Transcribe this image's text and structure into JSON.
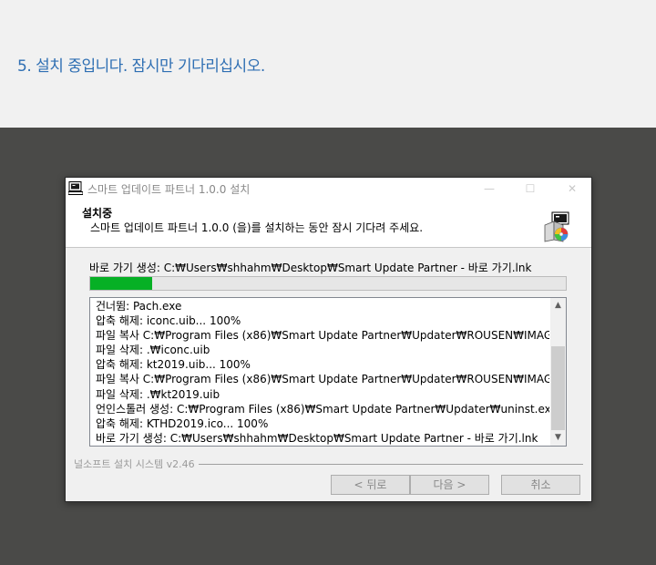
{
  "page": {
    "heading": "5. 설치 중입니다. 잠시만 기다리십시오."
  },
  "window": {
    "title": "스마트 업데이트 파트너 1.0.0  설치",
    "header_title": "설치중",
    "header_subtitle": "스마트 업데이트 파트너 1.0.0 (을)를 설치하는 동안 잠시 기다려 주세요.",
    "controls": {
      "minimize": "—",
      "maximize": "☐",
      "close": "✕"
    }
  },
  "progress": {
    "status_text": "바로 가기 생성: C:₩Users₩shhahm₩Desktop₩Smart Update Partner - 바로 가기.lnk",
    "fraction": 0.13
  },
  "log": {
    "lines": [
      "건너뜀: Pach.exe",
      "압축 해제: iconc.uib... 100%",
      "파일 복사 C:₩Program Files (x86)₩Smart Update Partner₩Updater₩ROUSEN₩IMAGE",
      "파일 삭제: .₩iconc.uib",
      "압축 해제: kt2019.uib... 100%",
      "파일 복사 C:₩Program Files (x86)₩Smart Update Partner₩Updater₩ROUSEN₩IMAGE",
      "파일 삭제: .₩kt2019.uib",
      "언인스톨러 생성: C:₩Program Files (x86)₩Smart Update Partner₩Updater₩uninst.exe",
      "압축 해제: KTHD2019.ico... 100%",
      "바로 가기 생성: C:₩Users₩shhahm₩Desktop₩Smart Update Partner - 바로 가기.lnk"
    ]
  },
  "footer": {
    "brand": "널소프트 설치 시스템 v2.46",
    "back_label": "< 뒤로",
    "next_label": "다음 >",
    "cancel_label": "취소"
  },
  "colors": {
    "heading": "#2f6fb3",
    "progress_fill": "#06b025",
    "dark_background": "#4a4a48"
  },
  "icons": {
    "app": "installer-app-icon",
    "setup": "setup-package-icon",
    "scroll_up": "chevron-up-icon",
    "scroll_down": "chevron-down-icon"
  }
}
